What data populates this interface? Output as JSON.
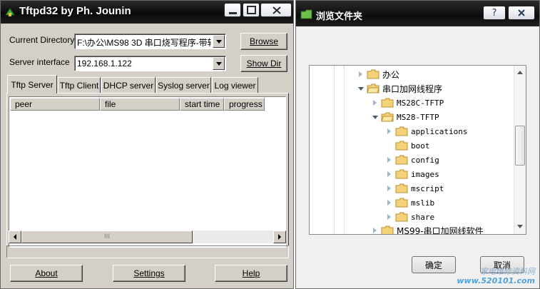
{
  "tftpd": {
    "title": "Tftpd32 by Ph. Jounin",
    "current_directory_label": "Current Directory",
    "current_directory_value": "F:\\办公\\MS98 3D 串口烧写程序-带转",
    "server_interface_label": "Server interface",
    "server_interface_value": "192.168.1.122",
    "browse_label": "Browse",
    "show_dir_label": "Show Dir",
    "tabs": [
      "Tftp Server",
      "Tftp Client",
      "DHCP server",
      "Syslog server",
      "Log viewer"
    ],
    "columns": [
      "peer",
      "file",
      "start time",
      "progress"
    ],
    "scroll_grip": "III",
    "about_label": "About",
    "settings_label": "Settings",
    "help_label": "Help"
  },
  "browse": {
    "title": "浏览文件夹",
    "help_glyph": "?",
    "tree": [
      {
        "label": "办公",
        "state": "collapsed",
        "level": 0
      },
      {
        "label": "串口加网线程序",
        "state": "expanded",
        "level": 0
      },
      {
        "label": "MS28C-TFTP",
        "state": "collapsed",
        "level": 1
      },
      {
        "label": "MS28-TFTP",
        "state": "expanded",
        "level": 1
      },
      {
        "label": "applications",
        "state": "collapsed",
        "level": 2
      },
      {
        "label": "boot",
        "state": "none",
        "level": 2
      },
      {
        "label": "config",
        "state": "collapsed",
        "level": 2
      },
      {
        "label": "images",
        "state": "collapsed",
        "level": 2
      },
      {
        "label": "mscript",
        "state": "collapsed",
        "level": 2
      },
      {
        "label": "mslib",
        "state": "collapsed",
        "level": 2
      },
      {
        "label": "share",
        "state": "collapsed",
        "level": 2
      },
      {
        "label": "MS99-串口加网线软件",
        "state": "collapsed",
        "level": 1
      }
    ],
    "ok_label": "确定",
    "cancel_label": "取消",
    "watermark_text": "家电维修资料网",
    "watermark_url": "www.520101.com"
  }
}
